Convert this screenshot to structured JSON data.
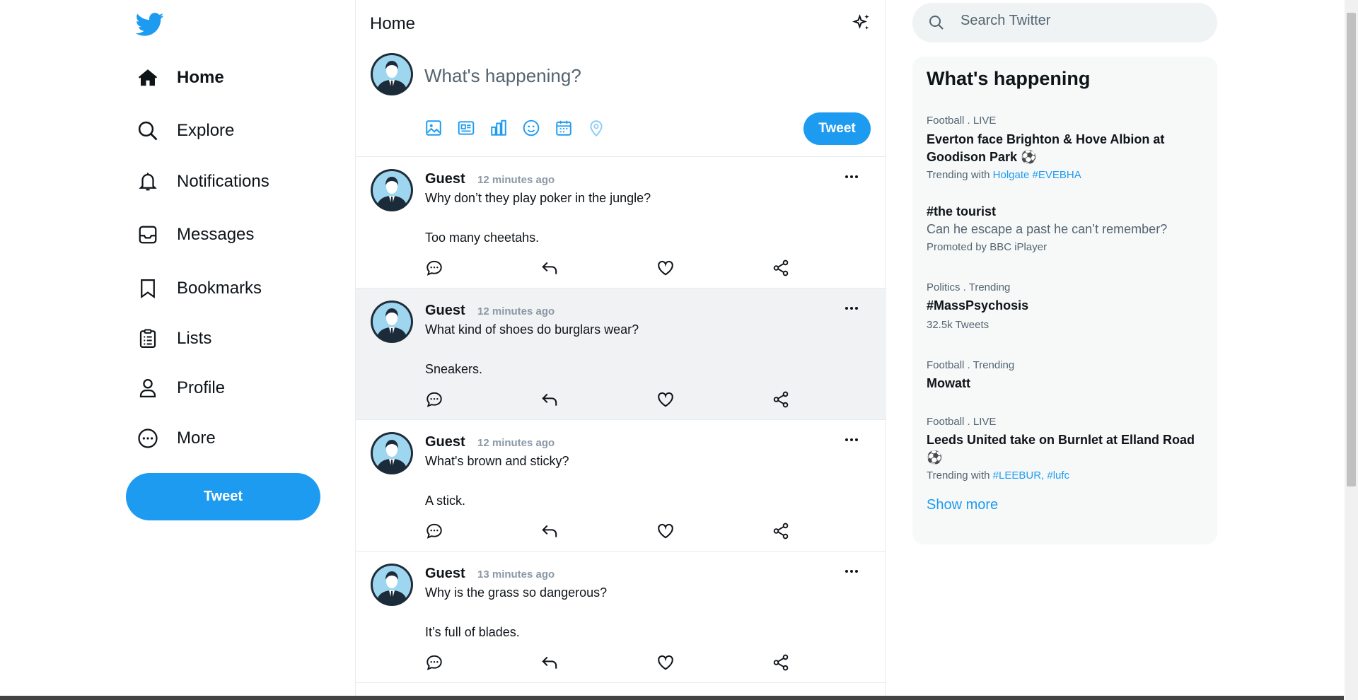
{
  "sidebar": {
    "nav": [
      {
        "label": "Home",
        "icon": "home-icon"
      },
      {
        "label": "Explore",
        "icon": "search-icon"
      },
      {
        "label": "Notifications",
        "icon": "bell-icon"
      },
      {
        "label": "Messages",
        "icon": "inbox-icon"
      },
      {
        "label": "Bookmarks",
        "icon": "bookmark-icon"
      },
      {
        "label": "Lists",
        "icon": "clipboard-icon"
      },
      {
        "label": "Profile",
        "icon": "person-icon"
      },
      {
        "label": "More",
        "icon": "more-circle-icon"
      }
    ],
    "tweet_button": "Tweet"
  },
  "main": {
    "title": "Home",
    "composer": {
      "placeholder": "What's happening?",
      "tweet_button": "Tweet",
      "tools": [
        "image-icon",
        "gif-icon",
        "poll-icon",
        "emoji-icon",
        "schedule-icon",
        "location-icon"
      ]
    },
    "tweets": [
      {
        "author": "Guest",
        "time": "12 minutes ago",
        "line1": "Why don’t they play poker in the jungle?",
        "line2": "Too many cheetahs."
      },
      {
        "author": "Guest",
        "time": "12 minutes ago",
        "line1": "What kind of shoes do burglars wear?",
        "line2": "Sneakers."
      },
      {
        "author": "Guest",
        "time": "12 minutes ago",
        "line1": "What's brown and sticky?",
        "line2": "A stick."
      },
      {
        "author": "Guest",
        "time": "13 minutes ago",
        "line1": "Why is the grass so dangerous?",
        "line2": "It’s full of blades."
      }
    ]
  },
  "search": {
    "placeholder": "Search Twitter"
  },
  "trends": {
    "title": "What's happening",
    "items": [
      {
        "meta": "Football . LIVE",
        "head": "Everton face Brighton & Hove Albion at Goodison Park ⚽",
        "sub_prefix": "Trending with ",
        "sub_link": "Holgate #EVEBHA"
      },
      {
        "head": "#the tourist",
        "desc": "Can he escape a past he can’t remember?",
        "sub": "Promoted by BBC iPlayer"
      },
      {
        "meta": "Politics . Trending",
        "head": "#MassPsychosis",
        "sub": "32.5k Tweets"
      },
      {
        "meta": "Football . Trending",
        "head": "Mowatt"
      },
      {
        "meta": "Football . LIVE",
        "head": "Leeds United take on Burnlet at Elland Road ⚽",
        "sub_prefix": "Trending with ",
        "sub_link": "#LEEBUR, #lufc"
      }
    ],
    "show_more": "Show more"
  },
  "colors": {
    "accent": "#1d9bf0",
    "hover_row": "#f1f2f4",
    "trend_bg": "#f7f9f9"
  }
}
